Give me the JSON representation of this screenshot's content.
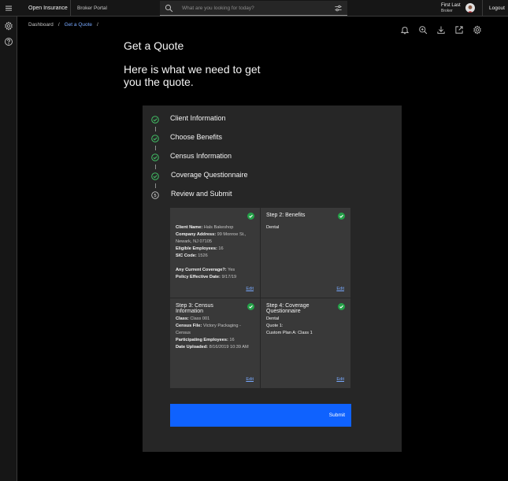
{
  "header": {
    "app_name": "Open Insurance",
    "nav_link": "Broker Portal",
    "search_placeholder": "What are you looking for today?",
    "user_name": "First Last",
    "user_role": "Broker",
    "logout_label": "Logout"
  },
  "breadcrumb": {
    "items": [
      "Dashboard",
      "Get a Quote"
    ],
    "separator": "/"
  },
  "page": {
    "title": "Get a Quote",
    "subtitle": "Here is what we need to get you the quote."
  },
  "steps": [
    {
      "label": "Client Information",
      "status": "complete"
    },
    {
      "label": "Choose Benefits",
      "status": "complete"
    },
    {
      "label": "Census Information",
      "status": "complete"
    },
    {
      "label": "Coverage Questionnaire",
      "status": "complete"
    },
    {
      "label": "Review and Submit",
      "status": "current",
      "number": "5"
    }
  ],
  "summary": {
    "step1": {
      "title": "",
      "client_name_label": "Client Name:",
      "client_name": "Hals Bakeshop",
      "address_label": "Company Address:",
      "address": "99 Monroe St., Newark, NJ 07105",
      "eligible_label": "Eligible Employees:",
      "eligible": "16",
      "sic_label": "SIC Code:",
      "sic": "1526",
      "coverage_label": "Any Current Coverage?:",
      "coverage": "Yes",
      "effective_label": "Policy Effective Date:",
      "effective": "9/17/19",
      "edit_label": "Edit"
    },
    "step2": {
      "title": "Step 2: Benefits",
      "benefit": "Dental",
      "edit_label": "Edit"
    },
    "step3": {
      "title": "Step 3: Census Information",
      "class_label": "Class:",
      "class": "Class 001",
      "file_label": "Census File:",
      "file": "Victory Packaging - Census",
      "participating_label": "Participating Employees:",
      "participating": "16",
      "uploaded_label": "Date Uploaded:",
      "uploaded": "8/16/2019 10:39 AM",
      "edit_label": "Edit"
    },
    "step4": {
      "title": "Step 4: Coverage Questionnaire",
      "benefit": "Dental",
      "quote": "Quote 1:",
      "plan": "Custom Plan A: Class 1",
      "edit_label": "Edit"
    }
  },
  "submit_label": "Submit",
  "colors": {
    "accent": "#0f62fe",
    "success": "#24a148",
    "link": "#78a9ff",
    "panel": "#262626",
    "tile": "#393939"
  },
  "icons": [
    "menu-icon",
    "search-icon",
    "filter-icon",
    "settings-icon",
    "help-icon",
    "notification-icon",
    "zoom-in-icon",
    "download-icon",
    "launch-icon",
    "checkmark-icon"
  ]
}
